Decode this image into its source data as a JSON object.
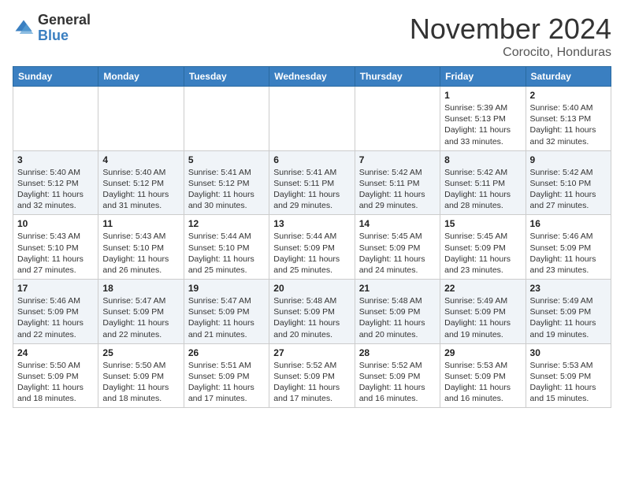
{
  "header": {
    "logo_general": "General",
    "logo_blue": "Blue",
    "month_title": "November 2024",
    "location": "Corocito, Honduras"
  },
  "weekdays": [
    "Sunday",
    "Monday",
    "Tuesday",
    "Wednesday",
    "Thursday",
    "Friday",
    "Saturday"
  ],
  "weeks": [
    [
      {
        "day": "",
        "info": ""
      },
      {
        "day": "",
        "info": ""
      },
      {
        "day": "",
        "info": ""
      },
      {
        "day": "",
        "info": ""
      },
      {
        "day": "",
        "info": ""
      },
      {
        "day": "1",
        "info": "Sunrise: 5:39 AM\nSunset: 5:13 PM\nDaylight: 11 hours\nand 33 minutes."
      },
      {
        "day": "2",
        "info": "Sunrise: 5:40 AM\nSunset: 5:13 PM\nDaylight: 11 hours\nand 32 minutes."
      }
    ],
    [
      {
        "day": "3",
        "info": "Sunrise: 5:40 AM\nSunset: 5:12 PM\nDaylight: 11 hours\nand 32 minutes."
      },
      {
        "day": "4",
        "info": "Sunrise: 5:40 AM\nSunset: 5:12 PM\nDaylight: 11 hours\nand 31 minutes."
      },
      {
        "day": "5",
        "info": "Sunrise: 5:41 AM\nSunset: 5:12 PM\nDaylight: 11 hours\nand 30 minutes."
      },
      {
        "day": "6",
        "info": "Sunrise: 5:41 AM\nSunset: 5:11 PM\nDaylight: 11 hours\nand 29 minutes."
      },
      {
        "day": "7",
        "info": "Sunrise: 5:42 AM\nSunset: 5:11 PM\nDaylight: 11 hours\nand 29 minutes."
      },
      {
        "day": "8",
        "info": "Sunrise: 5:42 AM\nSunset: 5:11 PM\nDaylight: 11 hours\nand 28 minutes."
      },
      {
        "day": "9",
        "info": "Sunrise: 5:42 AM\nSunset: 5:10 PM\nDaylight: 11 hours\nand 27 minutes."
      }
    ],
    [
      {
        "day": "10",
        "info": "Sunrise: 5:43 AM\nSunset: 5:10 PM\nDaylight: 11 hours\nand 27 minutes."
      },
      {
        "day": "11",
        "info": "Sunrise: 5:43 AM\nSunset: 5:10 PM\nDaylight: 11 hours\nand 26 minutes."
      },
      {
        "day": "12",
        "info": "Sunrise: 5:44 AM\nSunset: 5:10 PM\nDaylight: 11 hours\nand 25 minutes."
      },
      {
        "day": "13",
        "info": "Sunrise: 5:44 AM\nSunset: 5:09 PM\nDaylight: 11 hours\nand 25 minutes."
      },
      {
        "day": "14",
        "info": "Sunrise: 5:45 AM\nSunset: 5:09 PM\nDaylight: 11 hours\nand 24 minutes."
      },
      {
        "day": "15",
        "info": "Sunrise: 5:45 AM\nSunset: 5:09 PM\nDaylight: 11 hours\nand 23 minutes."
      },
      {
        "day": "16",
        "info": "Sunrise: 5:46 AM\nSunset: 5:09 PM\nDaylight: 11 hours\nand 23 minutes."
      }
    ],
    [
      {
        "day": "17",
        "info": "Sunrise: 5:46 AM\nSunset: 5:09 PM\nDaylight: 11 hours\nand 22 minutes."
      },
      {
        "day": "18",
        "info": "Sunrise: 5:47 AM\nSunset: 5:09 PM\nDaylight: 11 hours\nand 22 minutes."
      },
      {
        "day": "19",
        "info": "Sunrise: 5:47 AM\nSunset: 5:09 PM\nDaylight: 11 hours\nand 21 minutes."
      },
      {
        "day": "20",
        "info": "Sunrise: 5:48 AM\nSunset: 5:09 PM\nDaylight: 11 hours\nand 20 minutes."
      },
      {
        "day": "21",
        "info": "Sunrise: 5:48 AM\nSunset: 5:09 PM\nDaylight: 11 hours\nand 20 minutes."
      },
      {
        "day": "22",
        "info": "Sunrise: 5:49 AM\nSunset: 5:09 PM\nDaylight: 11 hours\nand 19 minutes."
      },
      {
        "day": "23",
        "info": "Sunrise: 5:49 AM\nSunset: 5:09 PM\nDaylight: 11 hours\nand 19 minutes."
      }
    ],
    [
      {
        "day": "24",
        "info": "Sunrise: 5:50 AM\nSunset: 5:09 PM\nDaylight: 11 hours\nand 18 minutes."
      },
      {
        "day": "25",
        "info": "Sunrise: 5:50 AM\nSunset: 5:09 PM\nDaylight: 11 hours\nand 18 minutes."
      },
      {
        "day": "26",
        "info": "Sunrise: 5:51 AM\nSunset: 5:09 PM\nDaylight: 11 hours\nand 17 minutes."
      },
      {
        "day": "27",
        "info": "Sunrise: 5:52 AM\nSunset: 5:09 PM\nDaylight: 11 hours\nand 17 minutes."
      },
      {
        "day": "28",
        "info": "Sunrise: 5:52 AM\nSunset: 5:09 PM\nDaylight: 11 hours\nand 16 minutes."
      },
      {
        "day": "29",
        "info": "Sunrise: 5:53 AM\nSunset: 5:09 PM\nDaylight: 11 hours\nand 16 minutes."
      },
      {
        "day": "30",
        "info": "Sunrise: 5:53 AM\nSunset: 5:09 PM\nDaylight: 11 hours\nand 15 minutes."
      }
    ]
  ]
}
